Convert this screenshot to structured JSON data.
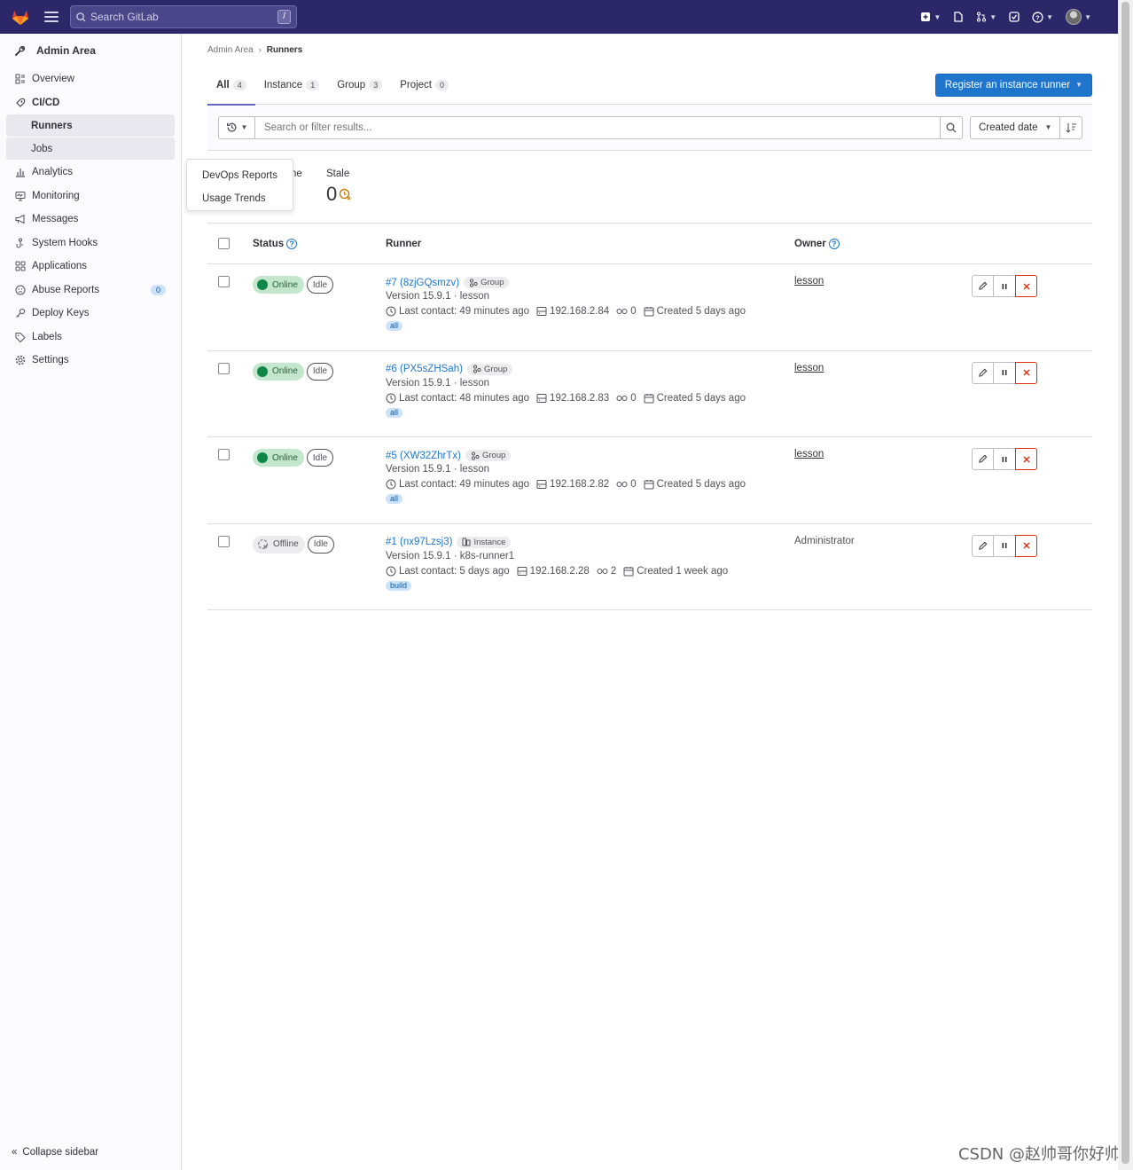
{
  "topbar": {
    "search_placeholder": "Search GitLab",
    "search_shortcut": "/"
  },
  "sidebar": {
    "title": "Admin Area",
    "items": [
      {
        "label": "Overview",
        "icon": "overview-icon"
      },
      {
        "label": "CI/CD",
        "icon": "rocket-icon"
      },
      {
        "label": "Analytics",
        "icon": "chart-icon"
      },
      {
        "label": "Monitoring",
        "icon": "monitor-icon"
      },
      {
        "label": "Messages",
        "icon": "bullhorn-icon"
      },
      {
        "label": "System Hooks",
        "icon": "hook-icon"
      },
      {
        "label": "Applications",
        "icon": "applications-icon"
      },
      {
        "label": "Abuse Reports",
        "icon": "abuse-icon",
        "badge": "0"
      },
      {
        "label": "Deploy Keys",
        "icon": "key-icon"
      },
      {
        "label": "Labels",
        "icon": "label-icon"
      },
      {
        "label": "Settings",
        "icon": "settings-icon"
      }
    ],
    "cicd_sub": [
      "Runners",
      "Jobs"
    ],
    "flyout": [
      "DevOps Reports",
      "Usage Trends"
    ],
    "collapse": "Collapse sidebar"
  },
  "breadcrumb": {
    "parent": "Admin Area",
    "current": "Runners"
  },
  "tabs": [
    {
      "label": "All",
      "count": "4"
    },
    {
      "label": "Instance",
      "count": "1"
    },
    {
      "label": "Group",
      "count": "3"
    },
    {
      "label": "Project",
      "count": "0"
    }
  ],
  "register_button": "Register an instance runner",
  "filter": {
    "placeholder": "Search or filter results...",
    "sort": "Created date"
  },
  "stats": {
    "partial_label": "ne",
    "stale_label": "Stale",
    "stale_value": "0"
  },
  "table_headers": {
    "status": "Status",
    "runner": "Runner",
    "owner": "Owner"
  },
  "runners": [
    {
      "status": "Online",
      "state": "Idle",
      "name": "#7 (8zjGQsmzv)",
      "type": "Group",
      "version": "Version 15.9.1 · lesson",
      "contact": "Last contact: 49 minutes ago",
      "ip": "192.168.2.84",
      "jobs": "0",
      "created": "Created 5 days ago",
      "tag": "all",
      "owner": "lesson",
      "owner_link": true
    },
    {
      "status": "Online",
      "state": "Idle",
      "name": "#6 (PX5sZHSah)",
      "type": "Group",
      "version": "Version 15.9.1 · lesson",
      "contact": "Last contact: 48 minutes ago",
      "ip": "192.168.2.83",
      "jobs": "0",
      "created": "Created 5 days ago",
      "tag": "all",
      "owner": "lesson",
      "owner_link": true
    },
    {
      "status": "Online",
      "state": "Idle",
      "name": "#5 (XW32ZhrTx)",
      "type": "Group",
      "version": "Version 15.9.1 · lesson",
      "contact": "Last contact: 49 minutes ago",
      "ip": "192.168.2.82",
      "jobs": "0",
      "created": "Created 5 days ago",
      "tag": "all",
      "owner": "lesson",
      "owner_link": true
    },
    {
      "status": "Offline",
      "state": "Idle",
      "name": "#1 (nx97Lzsj3)",
      "type": "Instance",
      "version": "Version 15.9.1 · k8s-runner1",
      "contact": "Last contact: 5 days ago",
      "ip": "192.168.2.28",
      "jobs": "2",
      "created": "Created 1 week ago",
      "tag": "build",
      "owner": "Administrator",
      "owner_link": false
    }
  ],
  "watermark": "CSDN @赵帅哥你好帅",
  "colors": {
    "navbar": "#2b2769",
    "primary": "#1f75cb",
    "online": "#108548",
    "danger": "#dd2b0e"
  }
}
